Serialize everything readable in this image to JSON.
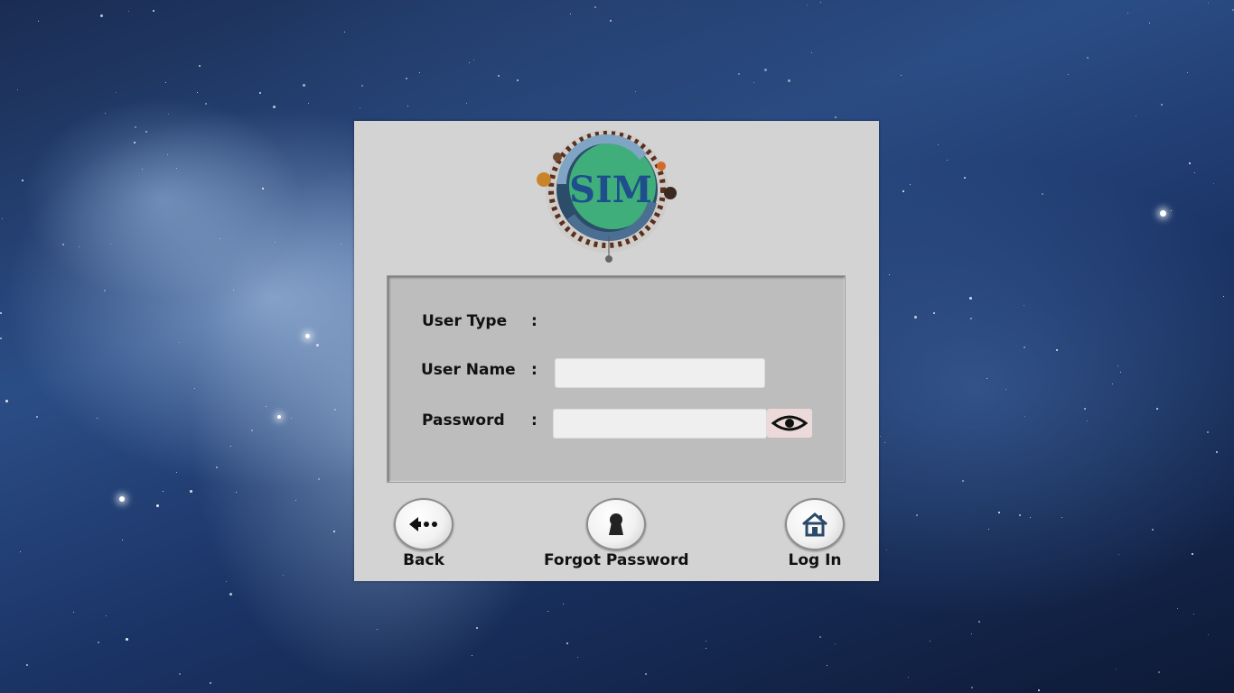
{
  "logo": {
    "text": "SIM"
  },
  "form": {
    "user_type_label": "User Type",
    "user_name_label": "User Name",
    "password_label": "Password",
    "colon": ":",
    "user_name_value": "",
    "password_value": ""
  },
  "icons": {
    "eye": "eye-icon",
    "back": "back-arrow-icon",
    "forgot": "keyhole-icon",
    "login": "home-icon"
  },
  "buttons": {
    "back_label": "Back",
    "forgot_label": "Forgot Password",
    "login_label": "Log In"
  },
  "colors": {
    "panel": "#d3d3d3",
    "form_box": "#bdbdbd",
    "logo_green": "#3fae7a",
    "logo_text": "#1e4f8c"
  }
}
